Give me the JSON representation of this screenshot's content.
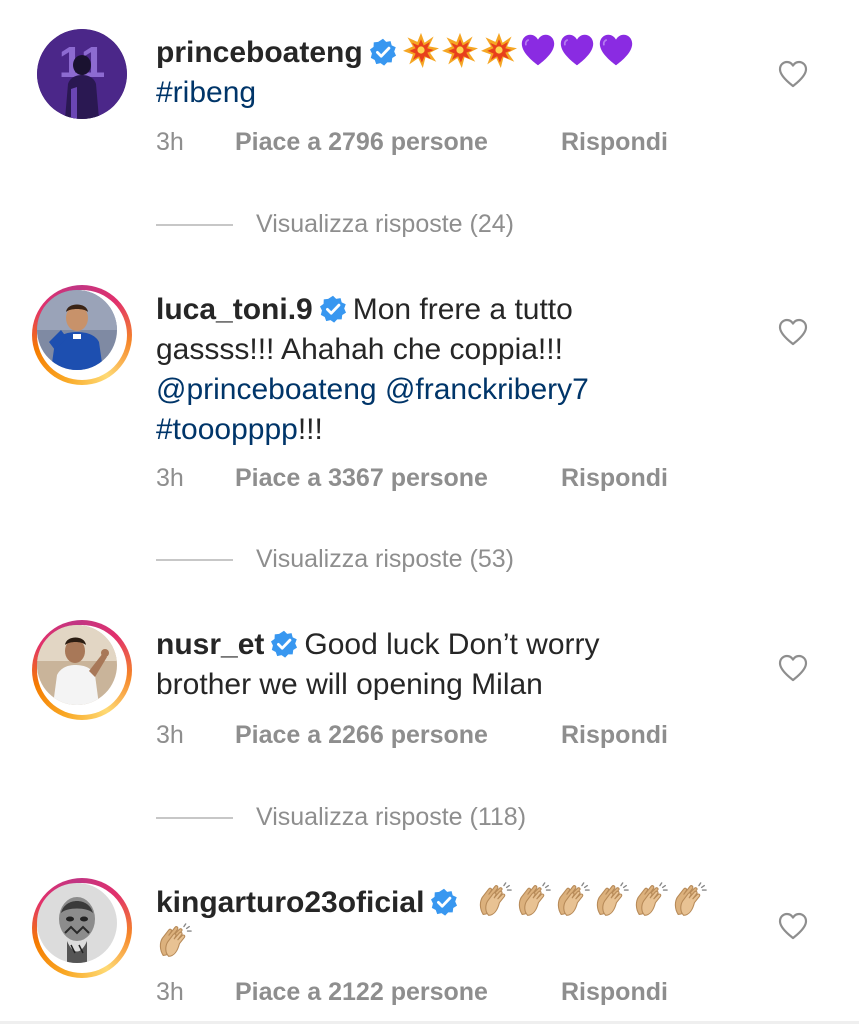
{
  "comments": [
    {
      "username": "princeboateng",
      "verified": true,
      "avatar_icon": "jersey-11-purple-avatar",
      "emojis_line1": [
        "collision",
        "collision",
        "collision",
        "purple-heart",
        "purple-heart",
        "purple-heart"
      ],
      "body_lines": [],
      "hashtag": "#ribeng",
      "time": "3h",
      "likes": "Piace a 2796 persone",
      "reply": "Rispondi",
      "view_replies": "Visualizza risposte (24)"
    },
    {
      "username": "luca_toni.9",
      "verified": true,
      "avatar_icon": "footballer-avatar",
      "line1_text": "Mon frere a tutto",
      "line2_text": "gassss!!! Ahahah che coppia!!!",
      "mention1": "@princeboateng",
      "mention2": "@franckribery7",
      "hashtag": "#tooopppp",
      "hashtag_suffix": "!!!",
      "time": "3h",
      "likes": "Piace a 3367 persone",
      "reply": "Rispondi",
      "view_replies": "Visualizza risposte (53)"
    },
    {
      "username": "nusr_et",
      "verified": true,
      "avatar_icon": "chef-avatar",
      "line1_text": "Good luck Don’t worry",
      "line2_text": "brother we will opening Milan",
      "time": "3h",
      "likes": "Piace a 2266 persone",
      "reply": "Rispondi",
      "view_replies": "Visualizza risposte (118)"
    },
    {
      "username": "kingarturo23oficial",
      "verified": true,
      "avatar_icon": "tattooed-portrait-avatar",
      "emojis": [
        "clapping-hands",
        "clapping-hands",
        "clapping-hands",
        "clapping-hands",
        "clapping-hands",
        "clapping-hands",
        "clapping-hands"
      ],
      "time": "3h",
      "likes": "Piace a 2122 persone",
      "reply": "Rispondi"
    }
  ],
  "colors": {
    "text": "#262626",
    "link": "#003569",
    "secondary": "#8e8e8e",
    "verified": "#3897f0",
    "divider": "#c7c7c7"
  }
}
